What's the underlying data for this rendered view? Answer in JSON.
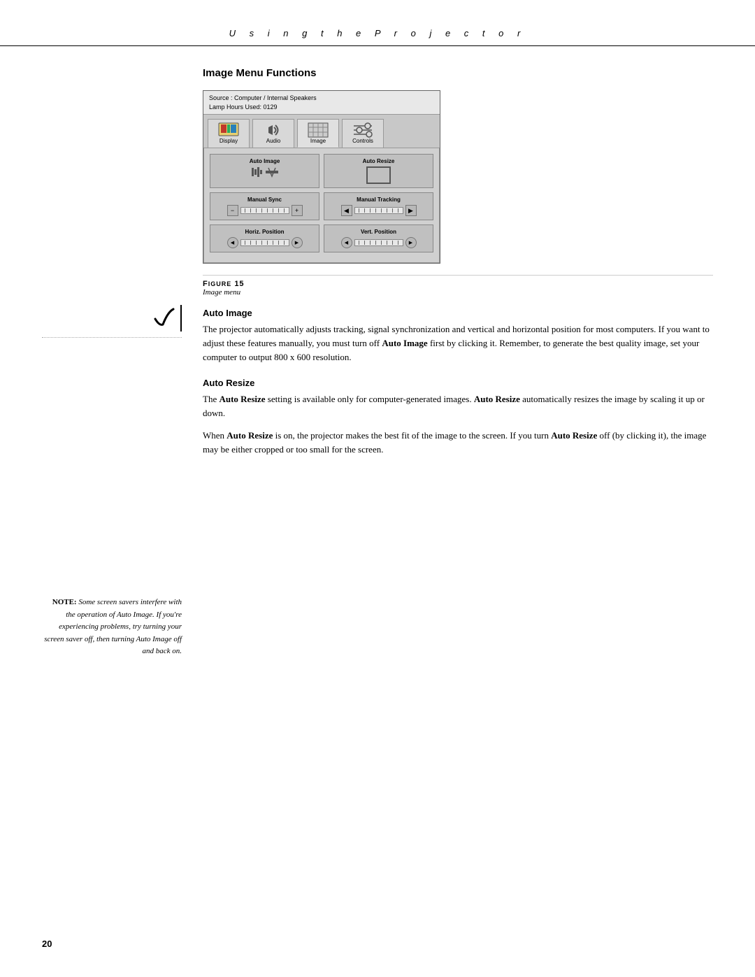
{
  "header": {
    "title": "U s i n g   t h e   P r o j e c t o r"
  },
  "section": {
    "title": "Image Menu Functions"
  },
  "projector_ui": {
    "info_line1": "Source : Computer / Internal Speakers",
    "info_line2": "Lamp Hours Used: 0129",
    "tabs": [
      {
        "label": "Display",
        "active": false
      },
      {
        "label": "Audio",
        "active": false
      },
      {
        "label": "Image",
        "active": true
      },
      {
        "label": "Controls",
        "active": false
      }
    ],
    "cells": [
      {
        "label": "Auto Image",
        "type": "auto-image"
      },
      {
        "label": "Auto Resize",
        "type": "auto-resize"
      },
      {
        "label": "Manual Sync",
        "type": "slider",
        "has_plusminus": true
      },
      {
        "label": "Manual Tracking",
        "type": "slider",
        "has_arrows": true
      },
      {
        "label": "Horiz. Position",
        "type": "slider-small"
      },
      {
        "label": "Vert. Position",
        "type": "slider-small"
      }
    ]
  },
  "figure": {
    "label": "Figure 15",
    "description": "Image menu"
  },
  "auto_image_section": {
    "title": "Auto Image",
    "paragraph1": "The projector automatically adjusts tracking, signal synchronization and vertical and horizontal position for most computers. If you want to adjust these features manually, you must turn off Auto Image first by clicking it. Remember, to generate the best quality image, set your computer to output 800 x 600 resolution.",
    "bold_phrase": "Auto Image"
  },
  "auto_resize_section": {
    "title": "Auto Resize",
    "paragraph1": "The Auto Resize setting is available only for computer-generated images. Auto Resize automatically resizes the image by scaling it up or down.",
    "paragraph2": "When Auto Resize is on, the projector makes the best fit of the image to the screen. If you turn Auto Resize off (by clicking it), the image may be either cropped or too small for the screen."
  },
  "sidebar_note": {
    "label": "NOTE:",
    "text": "Some screen savers interfere with the operation of Auto Image. If you're experiencing problems, try turning your screen saver off, then turning Auto Image off and back on."
  },
  "page_number": "20"
}
